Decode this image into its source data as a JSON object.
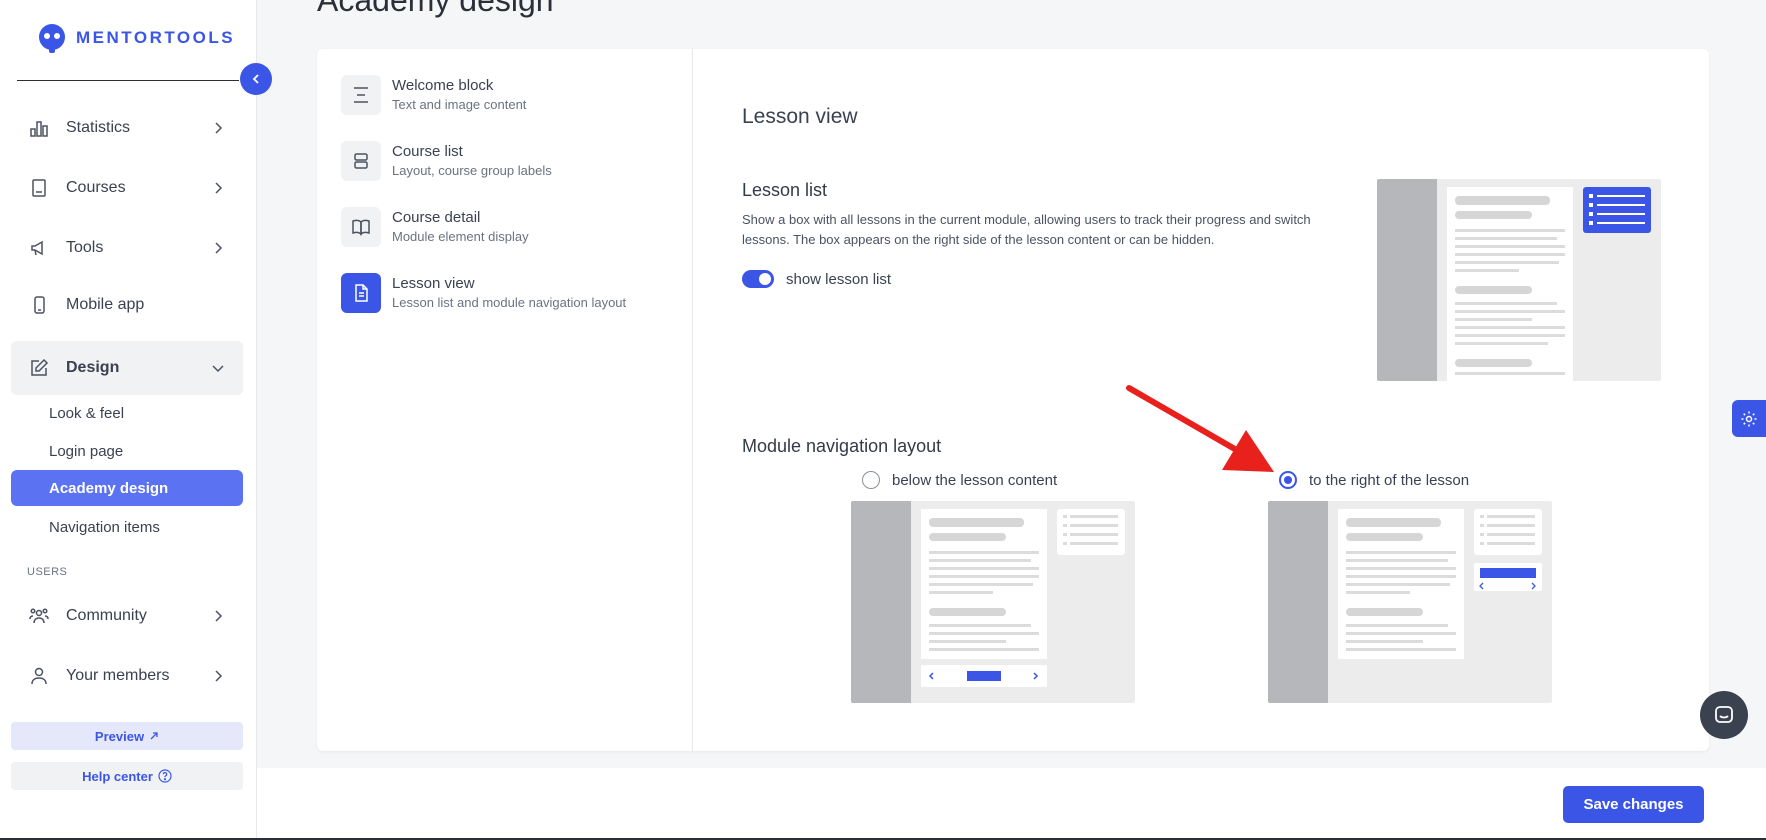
{
  "brand": {
    "name": "MENTORTOOLS",
    "accent": "#3b56e6"
  },
  "page": {
    "title": "Academy design"
  },
  "sidebar": {
    "nav": [
      {
        "label": "Statistics",
        "icon": "bar-chart-icon"
      },
      {
        "label": "Courses",
        "icon": "book-icon"
      },
      {
        "label": "Tools",
        "icon": "megaphone-icon"
      },
      {
        "label": "Mobile app",
        "icon": "phone-icon"
      },
      {
        "label": "Design",
        "icon": "pencil-icon"
      }
    ],
    "design_sub": [
      "Look & feel",
      "Login page",
      "Academy design",
      "Navigation items"
    ],
    "users_label": "USERS",
    "users_nav": [
      {
        "label": "Community",
        "icon": "people-icon"
      },
      {
        "label": "Your members",
        "icon": "user-icon"
      }
    ],
    "preview_label": "Preview",
    "help_label": "Help center"
  },
  "settings_menu": [
    {
      "title": "Welcome block",
      "sub": "Text and image content"
    },
    {
      "title": "Course list",
      "sub": "Layout, course group labels"
    },
    {
      "title": "Course detail",
      "sub": "Module element display"
    },
    {
      "title": "Lesson view",
      "sub": "Lesson list and module navigation layout"
    }
  ],
  "content": {
    "title": "Lesson view",
    "lesson_list": {
      "title": "Lesson list",
      "description": "Show a box with all lessons in the current module, allowing users to track their progress and switch lessons. The box appears on the right side of the lesson content or can be hidden.",
      "toggle_label": "show lesson list",
      "toggle_on": true
    },
    "module_nav": {
      "title": "Module navigation layout",
      "options": [
        "below the lesson content",
        "to the right of the lesson"
      ],
      "selected": "to the right of the lesson"
    }
  },
  "footer": {
    "save_label": "Save changes"
  }
}
